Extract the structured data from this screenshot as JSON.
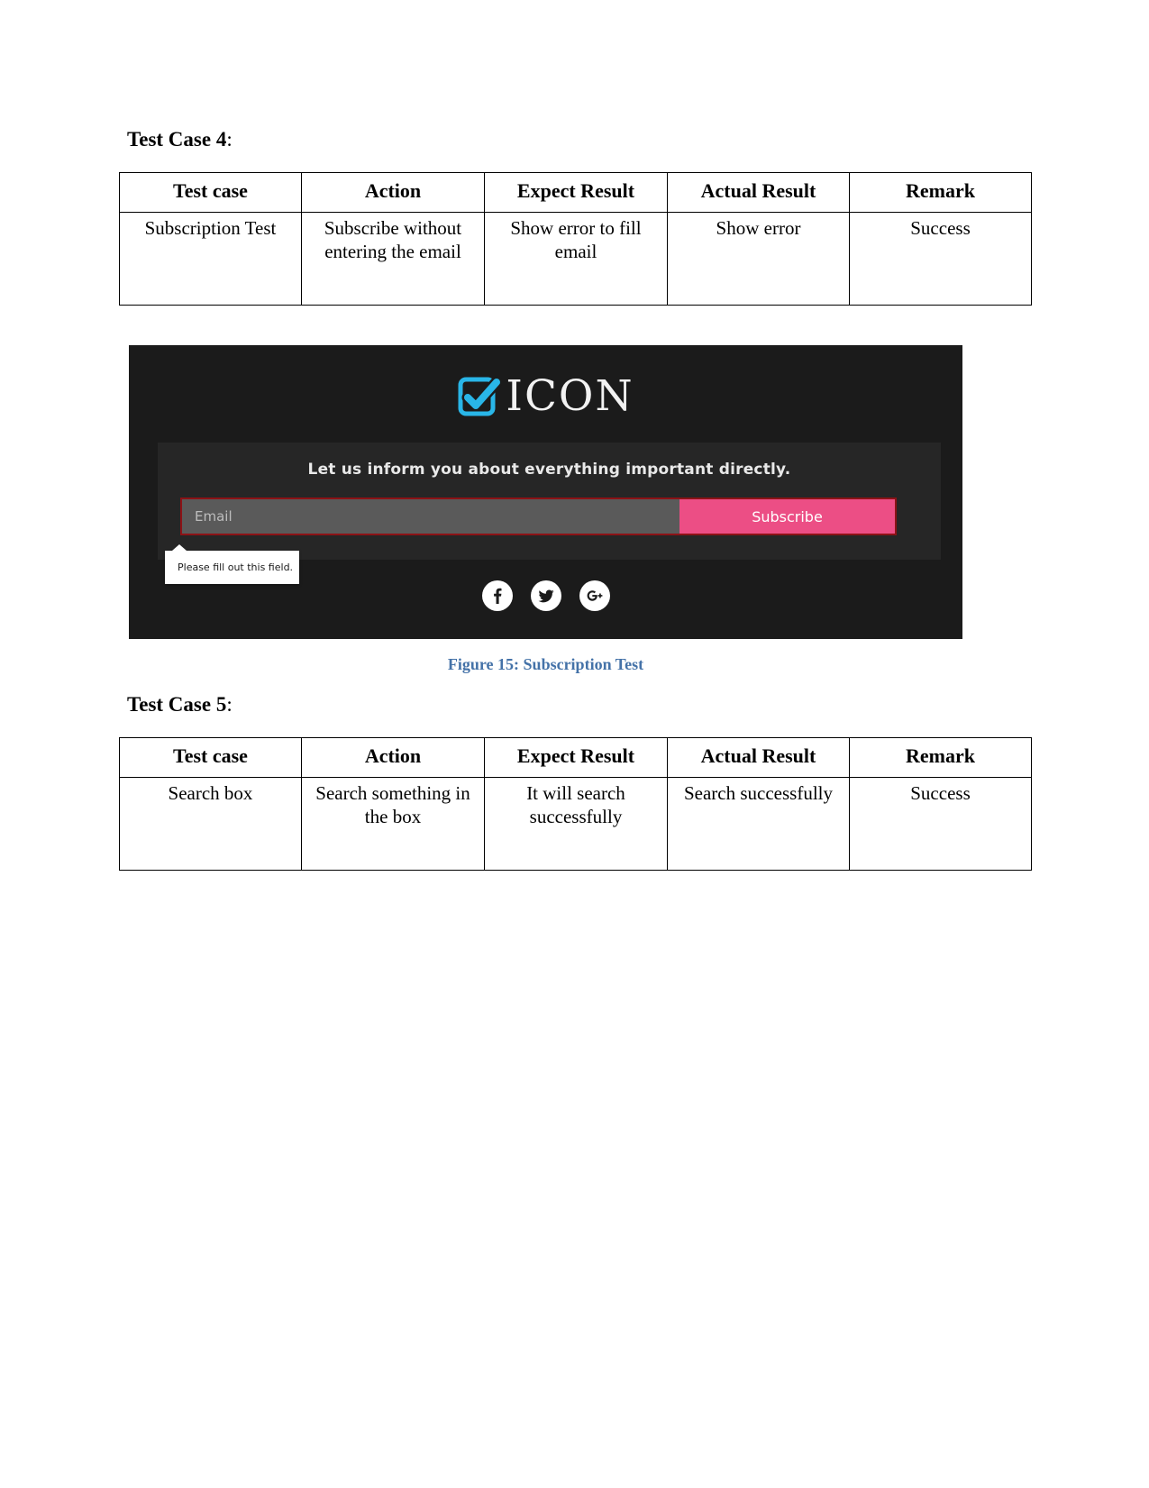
{
  "document": {
    "test_case_4": {
      "heading_label": "Test Case 4",
      "heading_colon": ":",
      "table": {
        "headers": [
          "Test case",
          "Action",
          "Expect Result",
          "Actual Result",
          "Remark"
        ],
        "rows": [
          [
            "Subscription Test",
            "Subscribe without entering the email",
            "Show error to fill email",
            "Show error",
            "Success"
          ]
        ]
      }
    },
    "test_case_5": {
      "heading_label": "Test Case 5",
      "heading_colon": ":",
      "table": {
        "headers": [
          "Test case",
          "Action",
          "Expect Result",
          "Actual Result",
          "Remark"
        ],
        "rows": [
          [
            "Search box",
            "Search something in the box",
            "It will search successfully",
            "Search successfully",
            "Success"
          ]
        ]
      }
    },
    "figure": {
      "caption": "Figure 15: Subscription Test",
      "caption_color": "#4472a8",
      "screenshot": {
        "background_color": "#1b1b1b",
        "panel_color": "#262626",
        "brand_name": "ICON",
        "brand_mark_icon": "checkbox-check-icon",
        "brand_mark_color": "#29b6e8",
        "tagline": "Let us inform you about everything important directly.",
        "email_placeholder": "Email",
        "email_value": "",
        "subscribe_label": "Subscribe",
        "subscribe_color": "#ec4e85",
        "input_border_color": "#8c1216",
        "validation_message": "Please fill out this field.",
        "social": [
          {
            "name": "facebook-icon",
            "label": "f"
          },
          {
            "name": "twitter-icon",
            "label": "t"
          },
          {
            "name": "google-plus-icon",
            "label": "G+"
          }
        ]
      }
    }
  }
}
